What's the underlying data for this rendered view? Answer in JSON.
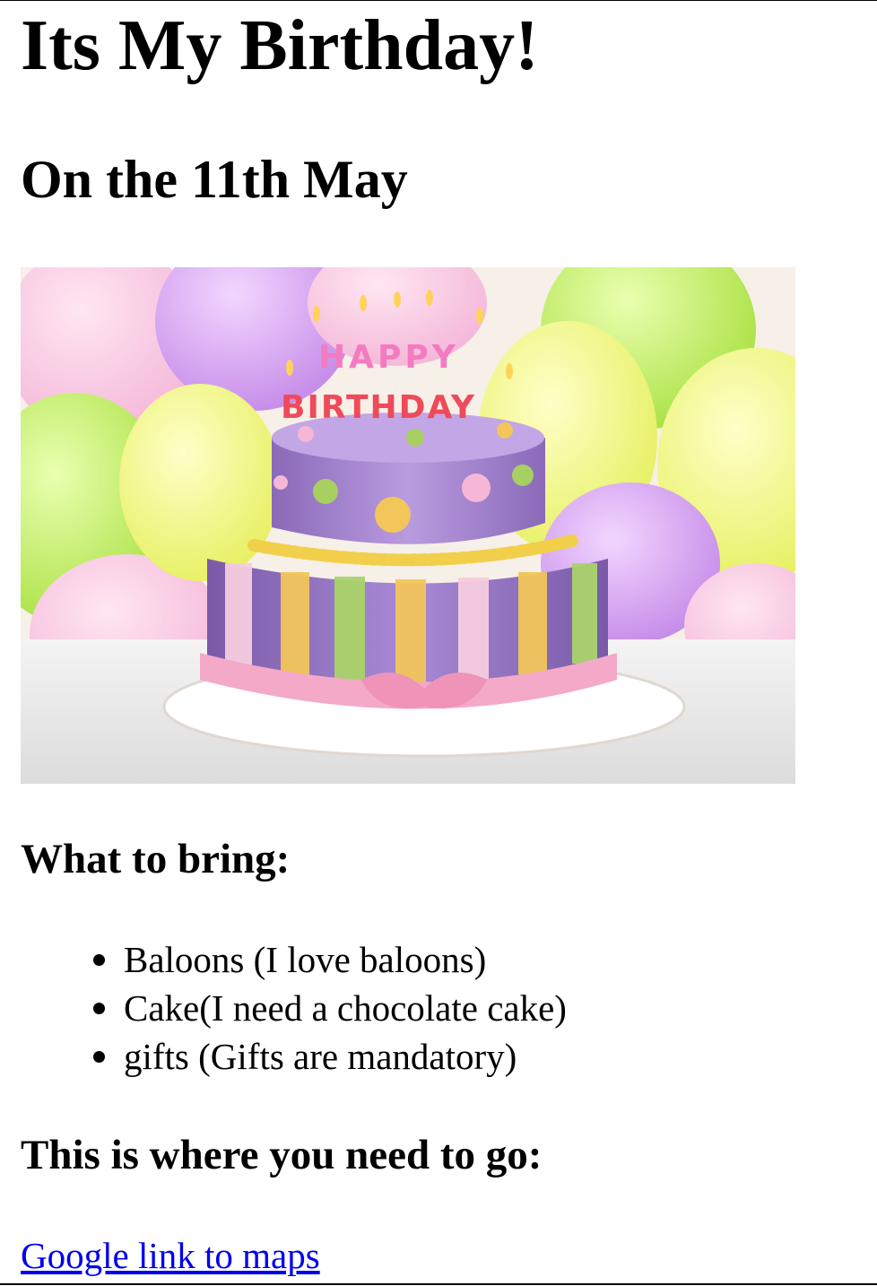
{
  "page": {
    "title": "Its My Birthday!",
    "date_heading": "On the 11th May",
    "bring_heading": "What to bring:",
    "items": [
      "Baloons (I love baloons)",
      "Cake(I need a chocolate cake)",
      "gifts (Gifts are mandatory)"
    ],
    "go_heading": "This is where you need to go:",
    "map_link": "Google link to maps"
  },
  "image": {
    "alt": "birthday-cake-photo",
    "candle_text_top": "HAPPY",
    "candle_text_bottom": "BIRTHDAY"
  },
  "colors": {
    "link": "#0000ee",
    "text": "#000000"
  }
}
